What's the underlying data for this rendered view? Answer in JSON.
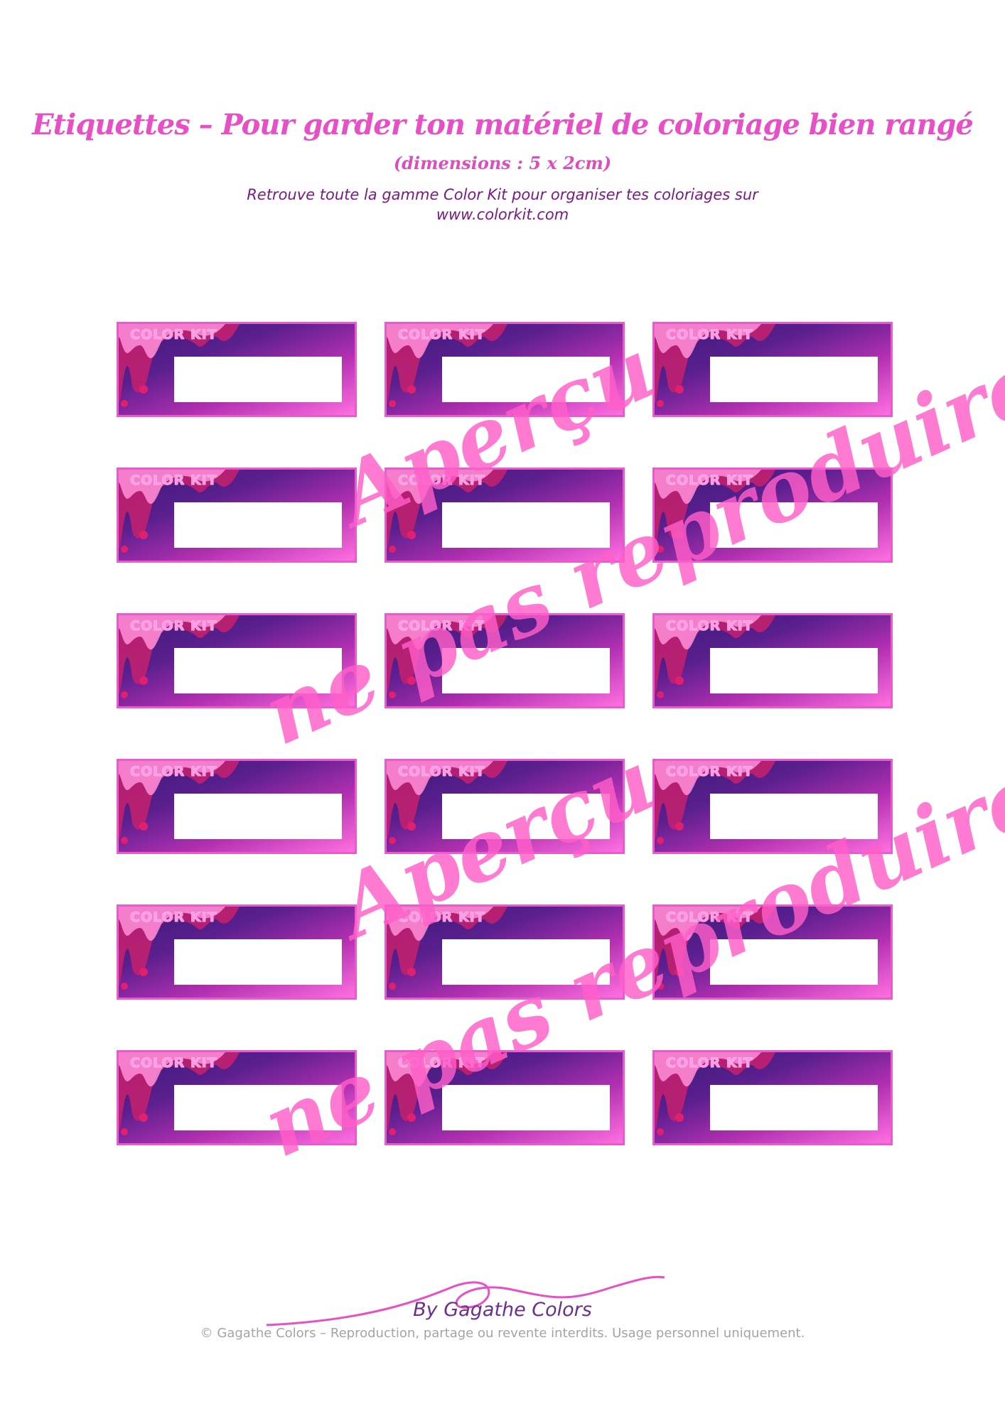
{
  "header": {
    "title": "Etiquettes – Pour garder ton matériel de coloriage bien rangé",
    "dimensions": "(dimensions : 5 x 2cm)",
    "subtitle_line1": "Retrouve toute la gamme Color Kit pour organiser tes coloriages sur",
    "subtitle_line2": "www.colorkit.com"
  },
  "label_brand": "COLOR KIT",
  "watermark": {
    "line1": "Aperçu",
    "line2": "ne pas reproduire"
  },
  "footer": {
    "signature": "By Gagathe Colors",
    "copyright": "© Gagathe Colors – Reproduction, partage ou revente interdits. Usage personnel uniquement."
  },
  "colors": {
    "title_pink": "#e64fc6",
    "subtitle_purple": "#7a1a86",
    "label_dark": "#3a1a78",
    "label_pink": "#ff6fe0",
    "watermark_pink": "#ff5fc8"
  }
}
